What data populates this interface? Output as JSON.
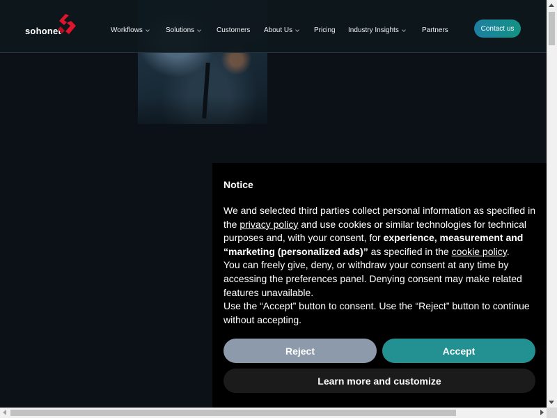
{
  "brand": {
    "logo_text": "sohonet",
    "logo_icon": "sohonet-logo-mark"
  },
  "nav": {
    "items": [
      {
        "label": "Workflows",
        "has_dropdown": true
      },
      {
        "label": "Solutions",
        "has_dropdown": true
      },
      {
        "label": "Customers",
        "has_dropdown": false
      },
      {
        "label": "About Us",
        "has_dropdown": true
      },
      {
        "label": "Pricing",
        "has_dropdown": false
      },
      {
        "label": "Industry Insights",
        "has_dropdown": true
      },
      {
        "label": "Partners",
        "has_dropdown": false
      }
    ],
    "contact_label": "Contact us"
  },
  "notice": {
    "title": "Notice",
    "p1_a": "We and selected third parties collect personal information as specified in the ",
    "privacy_link": "privacy policy",
    "p1_b": " and use cookies or similar technologies for technical purposes and, with your consent, for ",
    "p1_bold": "experience, measurement and “marketing (personalized ads)”",
    "p1_c": " as specified in the ",
    "cookie_link": "cookie policy",
    "p1_d": ".",
    "p2": "You can freely give, deny, or withdraw your consent at any time by accessing the preferences panel. Denying consent may make related features unavailable.",
    "p3": "Use the “Accept” button to consent. Use the “Reject” button to continue without accepting.",
    "reject_label": "Reject",
    "accept_label": "Accept",
    "learn_label": "Learn more and customize"
  },
  "colors": {
    "page_bg": "#0b1117",
    "accent_teal": "#239191",
    "reject_gray": "#8d9aab",
    "contact_gradient_start": "#1e7fa2",
    "contact_gradient_end": "#139284",
    "logo_red": "#e0142b"
  }
}
